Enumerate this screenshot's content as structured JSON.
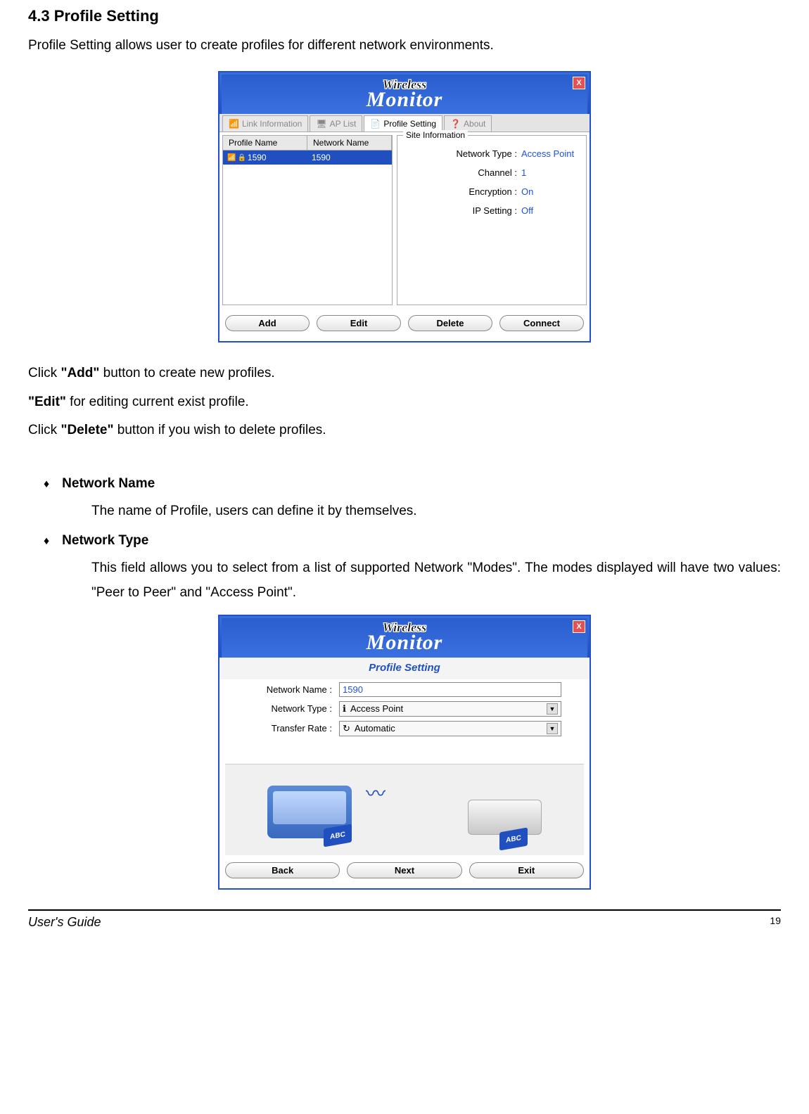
{
  "section": {
    "title": "4.3 Profile Setting",
    "intro": "Profile Setting allows user to create profiles for different network environments."
  },
  "window1": {
    "logo_wireless": "Wireless",
    "logo_monitor": "Monitor",
    "close": "X",
    "tabs": {
      "link": "Link Information",
      "aplist": "AP List",
      "profile": "Profile Setting",
      "about": "About"
    },
    "list_headers": {
      "profile": "Profile Name",
      "network": "Network Name"
    },
    "list_row": {
      "profile": "1590",
      "network": "1590"
    },
    "site_info_title": "Site Information",
    "info": {
      "network_type_label": "Network Type :",
      "network_type_value": "Access Point",
      "channel_label": "Channel :",
      "channel_value": "1",
      "encryption_label": "Encryption :",
      "encryption_value": "On",
      "ipsetting_label": "IP Setting :",
      "ipsetting_value": "Off"
    },
    "buttons": {
      "add": "Add",
      "edit": "Edit",
      "delete": "Delete",
      "connect": "Connect"
    }
  },
  "instructions": {
    "line1_pre": "Click ",
    "line1_bold": "\"Add\"",
    "line1_post": " button to create new profiles.",
    "line2_bold": "\"Edit\"",
    "line2_post": " for editing current exist profile.",
    "line3_pre": "Click ",
    "line3_bold": "\"Delete\"",
    "line3_post": " button if you wish to delete profiles."
  },
  "defs": {
    "network_name_title": "Network Name",
    "network_name_body": "The name of Profile, users can define it by themselves.",
    "network_type_title": "Network Type",
    "network_type_body": "This field allows you to select from a list of supported Network \"Modes\".  The modes displayed will have two values:  \"Peer to Peer\" and \"Access Point\"."
  },
  "window2": {
    "logo_wireless": "Wireless",
    "logo_monitor": "Monitor",
    "close": "X",
    "subtitle": "Profile Setting",
    "form": {
      "network_name_label": "Network Name :",
      "network_name_value": "1590",
      "network_type_label": "Network Type :",
      "network_type_value": "Access Point",
      "transfer_rate_label": "Transfer Rate :",
      "transfer_rate_value": "Automatic"
    },
    "illus": {
      "abc": "ABC"
    },
    "buttons": {
      "back": "Back",
      "next": "Next",
      "exit": "Exit"
    }
  },
  "footer": {
    "left": "User's Guide",
    "right": "19"
  }
}
